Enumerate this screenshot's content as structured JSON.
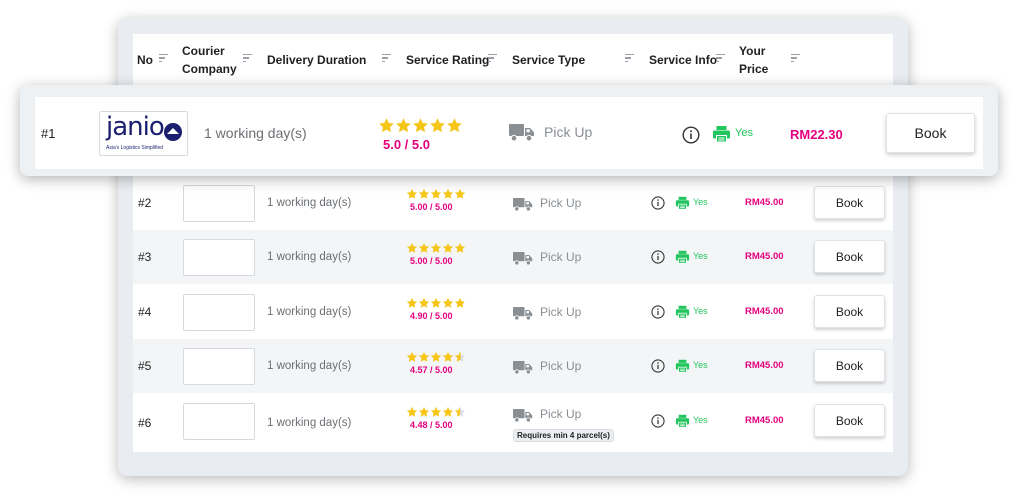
{
  "colors": {
    "accent_pink": "#e6007e",
    "star_gold": "#f5c518",
    "yes_green": "#22c55e",
    "brand_navy": "#1b1f6e"
  },
  "header": {
    "no": "No",
    "courier_line1": "Courier",
    "courier_line2": "Company",
    "delivery": "Delivery Duration",
    "rating": "Service Rating",
    "type": "Service Type",
    "info": "Service Info",
    "price_line1": "Your",
    "price_line2": "Price"
  },
  "highlight": {
    "number": "#1",
    "logo_word": "janio",
    "logo_tagline": "Asia's Logistics Simplified",
    "duration": "1 working day(s)",
    "stars": 5,
    "score": "5.0 / 5.0",
    "service_type": "Pick Up",
    "printer_label": "Yes",
    "price": "RM22.30",
    "book_label": "Book"
  },
  "rows": [
    {
      "number": "#2",
      "duration": "1 working day(s)",
      "stars": 5,
      "score": "5.00 / 5.00",
      "service_type": "Pick Up",
      "printer_label": "Yes",
      "price": "RM45.00",
      "book_label": "Book"
    },
    {
      "number": "#3",
      "duration": "1 working day(s)",
      "stars": 5,
      "score": "5.00 / 5.00",
      "service_type": "Pick Up",
      "printer_label": "Yes",
      "price": "RM45.00",
      "book_label": "Book"
    },
    {
      "number": "#4",
      "duration": "1 working day(s)",
      "stars": 4.9,
      "score": "4.90 / 5.00",
      "service_type": "Pick Up",
      "printer_label": "Yes",
      "price": "RM45.00",
      "book_label": "Book"
    },
    {
      "number": "#5",
      "duration": "1 working day(s)",
      "stars": 4.57,
      "score": "4.57 / 5.00",
      "service_type": "Pick Up",
      "printer_label": "Yes",
      "price": "RM45.00",
      "book_label": "Book"
    },
    {
      "number": "#6",
      "duration": "1 working day(s)",
      "stars": 4.48,
      "score": "4.48 / 5.00",
      "service_type": "Pick Up",
      "badge": "Requires min 4 parcel(s)",
      "printer_label": "Yes",
      "price": "RM45.00",
      "book_label": "Book"
    }
  ],
  "icons": {
    "sort": "sort-icon",
    "truck": "truck-icon",
    "info": "info-icon",
    "printer": "printer-icon",
    "star": "star-icon"
  }
}
